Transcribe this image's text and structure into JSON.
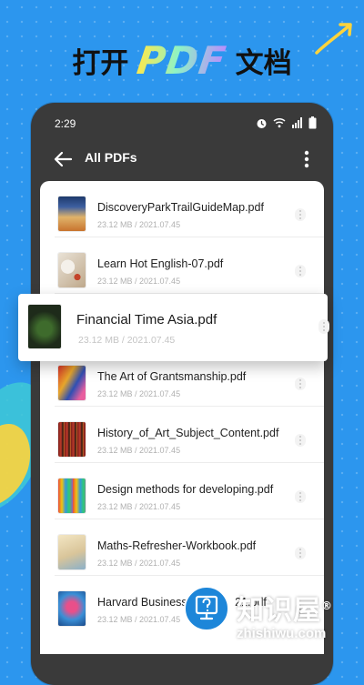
{
  "promo": {
    "text_left": "打开",
    "text_pdf": "PDF",
    "text_right": "文档"
  },
  "status_bar": {
    "time": "2:29"
  },
  "app_bar": {
    "title": "All PDFs"
  },
  "files": [
    {
      "name": "DiscoveryParkTrailGuideMap.pdf",
      "meta": "23.12 MB / 2021.07.45"
    },
    {
      "name": "Learn Hot English-07.pdf",
      "meta": "23.12 MB / 2021.07.45"
    },
    {
      "name": "Financial Time Asia.pdf",
      "meta": "23.12 MB / 2021.07.45"
    },
    {
      "name": "The Art of Grantsmanship.pdf",
      "meta": "23.12 MB / 2021.07.45"
    },
    {
      "name": "History_of_Art_Subject_Content.pdf",
      "meta": "23.12 MB / 2021.07.45"
    },
    {
      "name": "Design methods for developing.pdf",
      "meta": "23.12 MB / 2021.07.45"
    },
    {
      "name": "Maths-Refresher-Workbook.pdf",
      "meta": "23.12 MB / 2021.07.45"
    },
    {
      "name": "Harvard Business R",
      "name_suffix": "21.pdf",
      "meta": "23.12 MB / 2021.07.45"
    }
  ],
  "watermark": {
    "title": "知识屋",
    "registered": "®",
    "url": "zhishiwu.com"
  },
  "colors": {
    "background": "#2c96ee",
    "phone_frame": "#3a3a3a",
    "card": "#ffffff"
  },
  "icons": {
    "back": "arrow-left-icon",
    "more": "more-vertical-icon",
    "alarm": "alarm-icon",
    "wifi": "wifi-icon",
    "signal": "signal-icon",
    "battery": "battery-icon"
  }
}
